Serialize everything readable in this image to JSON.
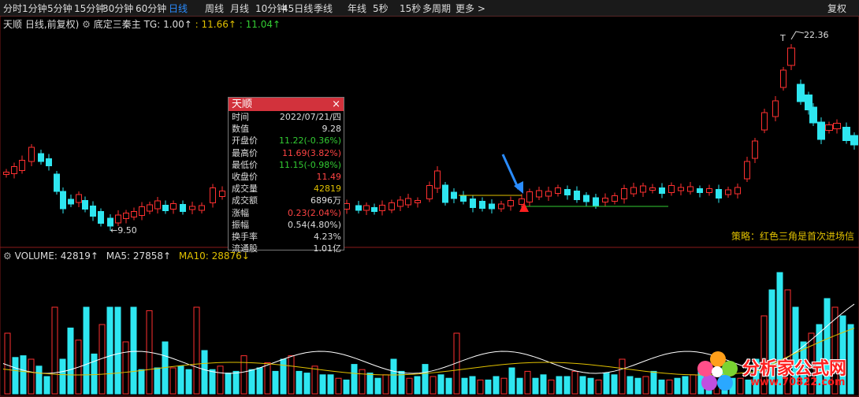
{
  "toolbar": {
    "tabs": [
      "分时",
      "1分钟",
      "5分钟",
      "15分钟",
      "30分钟",
      "60分钟",
      "日线",
      "周线",
      "月线",
      "10分钟",
      "45日线",
      "季线",
      "年线",
      "5秒",
      "15秒",
      "多周期",
      "更多 >"
    ],
    "active_tab": "日线",
    "fuquan": "复权"
  },
  "indicator": {
    "stock_label": "天顺 日线,前复权)",
    "name": "底定三秦主",
    "tg": "TG: 1.00↑",
    "v1": ": 11.66↑",
    "v2": ": 11.04↑"
  },
  "annotations": {
    "low": "←9.50",
    "high": "22.36",
    "t_marker": "T",
    "strategy": "策略：红色三角是首次进场信"
  },
  "volume": {
    "label": "VOLUME: 42819↑",
    "ma5": "MA5: 27858↑",
    "ma10": "MA10: 28876↓"
  },
  "popup": {
    "title": "天顺",
    "close": "×",
    "rows": [
      {
        "label": "时间",
        "value": "2022/07/21/四",
        "color": "#dddddd"
      },
      {
        "label": "数值",
        "value": "9.28",
        "color": "#dddddd"
      },
      {
        "label": "开盘价",
        "value": "11.22(-0.36%)",
        "color": "#33cc33"
      },
      {
        "label": "最高价",
        "value": "11.69(3.82%)",
        "color": "#ff4444"
      },
      {
        "label": "最低价",
        "value": "11.15(-0.98%)",
        "color": "#33cc33"
      },
      {
        "label": "收盘价",
        "value": "11.49",
        "color": "#ff4444"
      },
      {
        "label": "成交量",
        "value": "42819",
        "color": "#e0c000"
      },
      {
        "label": "成交额",
        "value": "6896万",
        "color": "#dddddd"
      },
      {
        "label": "涨幅",
        "value": "0.23(2.04%)",
        "color": "#ff4444"
      },
      {
        "label": "振幅",
        "value": "0.54(4.80%)",
        "color": "#dddddd"
      },
      {
        "label": "换手率",
        "value": "4.23%",
        "color": "#dddddd"
      },
      {
        "label": "流通股",
        "value": "1.01亿",
        "color": "#dddddd"
      }
    ]
  },
  "watermark": {
    "text": "分析家公式网",
    "url": "www.70822.com"
  },
  "colors": {
    "up": "#ff3030",
    "down": "#2ee6f0",
    "bg": "#000000",
    "accent": "#2a8cff",
    "yellow": "#e0c000"
  }
}
